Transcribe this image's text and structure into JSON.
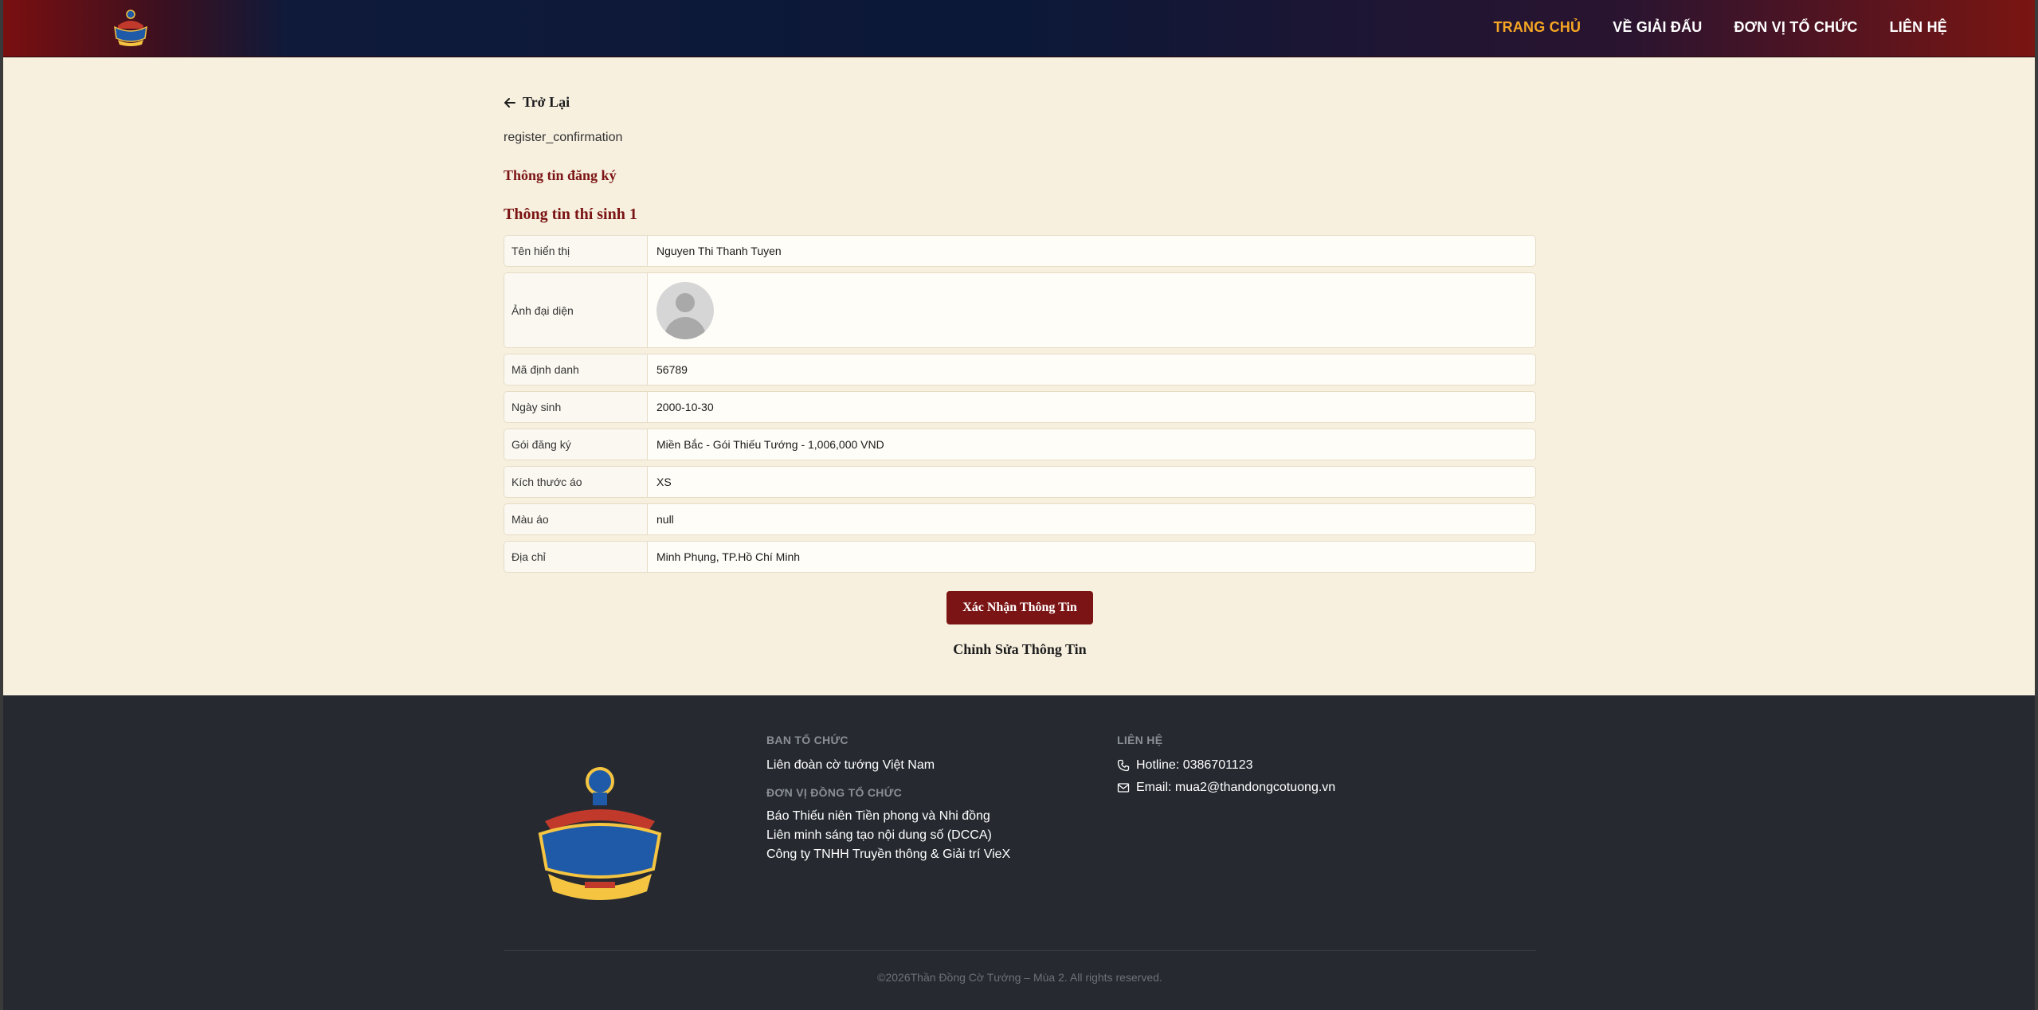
{
  "header": {
    "logo_alt": "Thần Đồng Cờ Tướng logo",
    "nav": [
      {
        "label": "TRANG CHỦ",
        "active": true
      },
      {
        "label": "VỀ GIẢI ĐẤU",
        "active": false
      },
      {
        "label": "ĐƠN VỊ TỔ CHỨC",
        "active": false
      },
      {
        "label": "LIÊN HỆ",
        "active": false
      }
    ]
  },
  "main": {
    "back_label": "Trở Lại",
    "page_key": "register_confirmation",
    "section_title": "Thông tin đăng ký",
    "candidate_title": "Thông tin thí sinh 1",
    "rows": [
      {
        "label": "Tên hiển thị",
        "value": "Nguyen Thi Thanh Tuyen"
      },
      {
        "label": "Ảnh đại diện",
        "value": ""
      },
      {
        "label": "Mã định danh",
        "value": "56789"
      },
      {
        "label": "Ngày sinh",
        "value": "2000-10-30"
      },
      {
        "label": "Gói đăng ký",
        "value": "Miền Bắc - Gói Thiếu Tướng - 1,006,000 VND"
      },
      {
        "label": "Kích thước áo",
        "value": "XS"
      },
      {
        "label": "Màu áo",
        "value": "null"
      },
      {
        "label": "Địa chỉ",
        "value": "Minh Phụng, TP.Hồ Chí Minh"
      }
    ],
    "confirm_button": "Xác Nhận Thông Tin",
    "edit_link": "Chỉnh Sửa Thông Tin"
  },
  "footer": {
    "organizer_heading": "BAN TỔ CHỨC",
    "organizer": "Liên đoàn cờ tướng Việt Nam",
    "co_organizer_heading": "ĐƠN VỊ ĐỒNG TỔ CHỨC",
    "co_organizers": [
      "Báo Thiếu niên Tiền phong và Nhi đồng",
      "Liên minh sáng tạo nội dung số (DCCA)",
      "Công ty TNHH Truyền thông & Giải trí VieX"
    ],
    "contact_heading": "LIÊN HỆ",
    "hotline": "Hotline: 0386701123",
    "email": "Email: mua2@thandongcotuong.vn",
    "copyright": "©2026Thần Đồng Cờ Tướng – Mùa 2. All rights reserved."
  },
  "colors": {
    "accent": "#7b1414",
    "nav_active": "#f5a623",
    "page_bg": "#f7f0df",
    "footer_bg": "#262a30"
  },
  "icons": [
    "arrow-left-icon",
    "phone-icon",
    "mail-icon",
    "avatar-placeholder-icon"
  ]
}
